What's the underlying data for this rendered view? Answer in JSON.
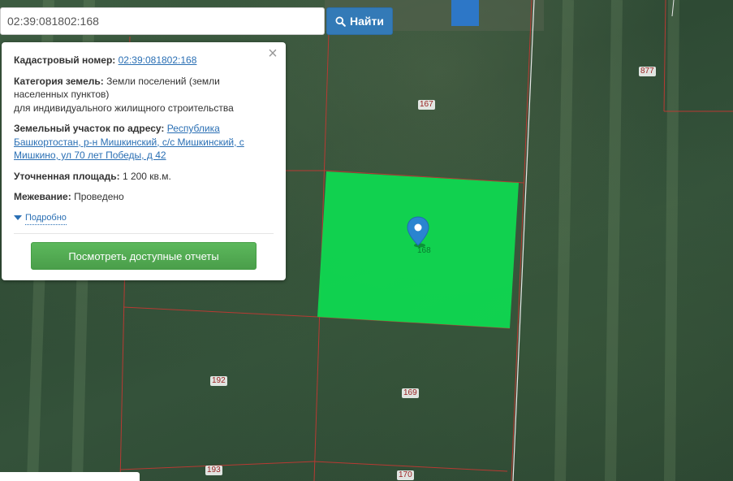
{
  "search": {
    "value": "02:39:081802:168",
    "button_label": "Найти"
  },
  "popup": {
    "cadastral_label": "Кадастровый номер:",
    "cadastral_value": "02:39:081802:168",
    "category_label": "Категория земель:",
    "category_value_line1": "Земли поселений (земли",
    "category_value_line2": "населенных пунктов)",
    "category_value_line3": "для индивидуального жилищного строительства",
    "address_label": "Земельный участок по адресу:",
    "address_value_line1": "Республика",
    "address_value_line2": "Башкортостан, р-н Мишкинский, с/с Мишкинский, с",
    "address_value_line3": "Мишкино, ул 70 лет Победы, д 42",
    "area_label": "Уточненная площадь:",
    "area_value": "1 200 кв.м.",
    "survey_label": "Межевание:",
    "survey_value": "Проведено",
    "details_label": "Подробно",
    "report_button": "Посмотреть доступные отчеты",
    "close_glyph": "×"
  },
  "map": {
    "plot_labels": [
      "877",
      "167",
      "192",
      "169",
      "193",
      "170"
    ],
    "selected_label": "168",
    "selected_color": "#0fd850",
    "boundary_color": "#c0392b",
    "marker_color": "#2a84d0"
  }
}
